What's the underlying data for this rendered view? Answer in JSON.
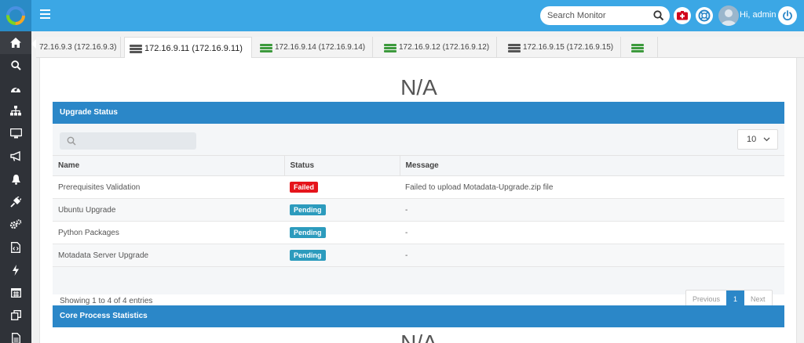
{
  "header": {
    "search_placeholder": "Search Monitor",
    "greeting": "Hi, admin"
  },
  "tabs": [
    {
      "label": "72.16.9.3 (172.16.9.3)",
      "active": false
    },
    {
      "label": "172.16.9.11 (172.16.9.11)",
      "active": true
    },
    {
      "label": "172.16.9.14 (172.16.9.14)",
      "active": false
    },
    {
      "label": "172.16.9.12 (172.16.9.12)",
      "active": false
    },
    {
      "label": "172.16.9.15 (172.16.9.15)",
      "active": false
    },
    {
      "label": "",
      "active": false
    }
  ],
  "main": {
    "title": "N/A",
    "title2": "N/A"
  },
  "upgrade": {
    "heading": "Upgrade Status",
    "page_size": "10",
    "columns": [
      "Name",
      "Status",
      "Message"
    ],
    "rows": [
      {
        "name": "Prerequisites Validation",
        "status": "Failed",
        "message": "Failed to upload Motadata-Upgrade.zip file"
      },
      {
        "name": "Ubuntu Upgrade",
        "status": "Pending",
        "message": "-"
      },
      {
        "name": "Python Packages",
        "status": "Pending",
        "message": "-"
      },
      {
        "name": "Motadata Server Upgrade",
        "status": "Pending",
        "message": "-"
      }
    ],
    "info": "Showing 1 to 4 of 4 entries",
    "pager": {
      "previous": "Previous",
      "current": "1",
      "next": "Next"
    }
  },
  "core": {
    "heading": "Core Process Statistics"
  },
  "colors": {
    "header": "#3ba7e5",
    "sidebar": "#2f3238",
    "card_head": "#2b87c8",
    "failed": "#e5141b",
    "pending": "#2c9bbd"
  },
  "sidebar_icons": [
    "home-icon",
    "search-icon",
    "dashboard-icon",
    "topology-icon",
    "monitor-icon",
    "announcement-icon",
    "bell-icon",
    "plug-icon",
    "cogs-icon",
    "document-code-icon",
    "bolt-icon",
    "calendar-icon",
    "copy-icon",
    "file-icon"
  ]
}
